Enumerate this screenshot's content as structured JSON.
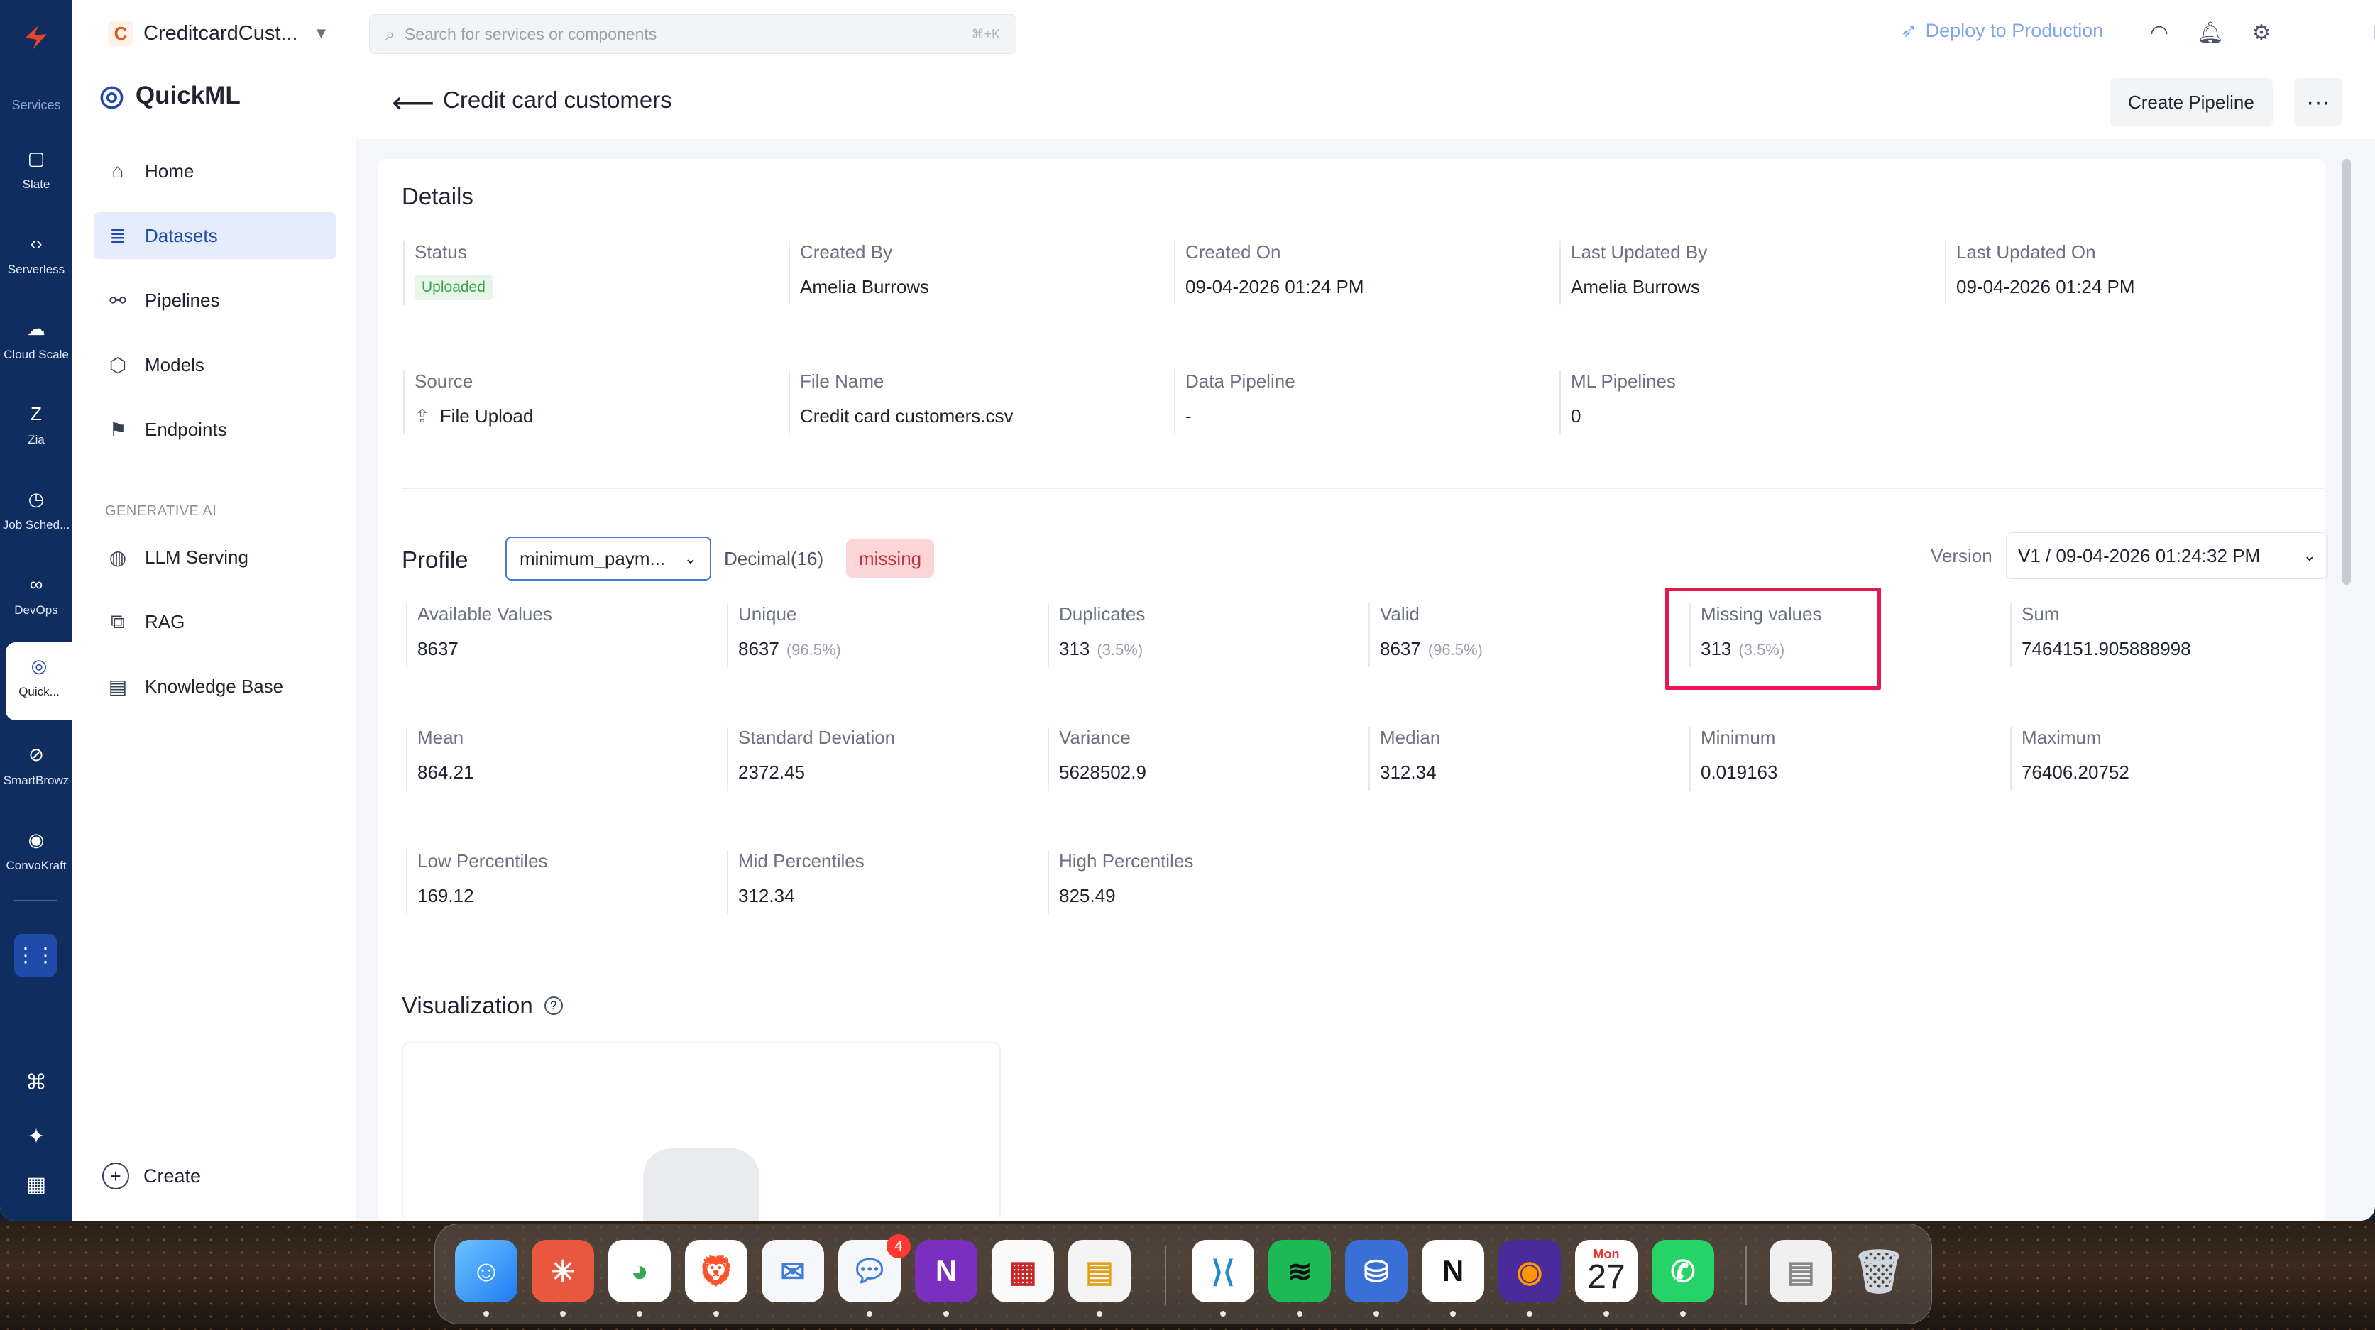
{
  "rail": {
    "services_label": "Services",
    "items": [
      {
        "label": "Slate",
        "icon": "slate-icon"
      },
      {
        "label": "Serverless",
        "icon": "serverless-icon"
      },
      {
        "label": "Cloud Scale",
        "icon": "cloud-scale-icon"
      },
      {
        "label": "Zia",
        "icon": "zia-icon"
      },
      {
        "label": "Job Sched...",
        "icon": "job-scheduling-icon"
      },
      {
        "label": "DevOps",
        "icon": "devops-icon"
      },
      {
        "label": "Quick...",
        "icon": "quickml-icon"
      },
      {
        "label": "SmartBrowz",
        "icon": "smartbrowz-icon"
      },
      {
        "label": "ConvoKraft",
        "icon": "convokraft-icon"
      }
    ]
  },
  "topbar": {
    "project_initial": "C",
    "project_name": "CreditcardCust...",
    "search_placeholder": "Search for services or components",
    "search_shortcut": "⌘+K",
    "deploy_label": "Deploy to Production"
  },
  "sidebar": {
    "title": "QuickML",
    "items": [
      {
        "label": "Home"
      },
      {
        "label": "Datasets"
      },
      {
        "label": "Pipelines"
      },
      {
        "label": "Models"
      },
      {
        "label": "Endpoints"
      }
    ],
    "section_label": "GENERATIVE AI",
    "gen_items": [
      {
        "label": "LLM Serving"
      },
      {
        "label": "RAG"
      },
      {
        "label": "Knowledge Base"
      }
    ],
    "create_label": "Create"
  },
  "page": {
    "title": "Credit card customers",
    "create_pipeline": "Create Pipeline",
    "more": "···"
  },
  "details": {
    "heading": "Details",
    "status_label": "Status",
    "status_value": "Uploaded",
    "created_by_label": "Created By",
    "created_by": "Amelia Burrows",
    "created_on_label": "Created On",
    "created_on": "09-04-2026 01:24 PM",
    "updated_by_label": "Last Updated By",
    "updated_by": "Amelia Burrows",
    "updated_on_label": "Last Updated On",
    "updated_on": "09-04-2026 01:24 PM",
    "source_label": "Source",
    "source_value": "File Upload",
    "file_name_label": "File Name",
    "file_name": "Credit card customers.csv",
    "data_pipeline_label": "Data Pipeline",
    "data_pipeline": "-",
    "ml_pipelines_label": "ML Pipelines",
    "ml_pipelines": "0"
  },
  "profile": {
    "heading": "Profile",
    "column": "minimum_paym...",
    "dtype": "Decimal(16)",
    "tag": "missing",
    "version_label": "Version",
    "version_value": "V1 / 09-04-2026 01:24:32 PM",
    "stats": [
      {
        "label": "Available Values",
        "value": "8637",
        "sub": ""
      },
      {
        "label": "Unique",
        "value": "8637",
        "sub": "(96.5%)"
      },
      {
        "label": "Duplicates",
        "value": "313",
        "sub": "(3.5%)"
      },
      {
        "label": "Valid",
        "value": "8637",
        "sub": "(96.5%)"
      },
      {
        "label": "Missing values",
        "value": "313",
        "sub": "(3.5%)"
      },
      {
        "label": "Sum",
        "value": "7464151.905888998",
        "sub": ""
      },
      {
        "label": "Mean",
        "value": "864.21",
        "sub": ""
      },
      {
        "label": "Standard Deviation",
        "value": "2372.45",
        "sub": ""
      },
      {
        "label": "Variance",
        "value": "5628502.9",
        "sub": ""
      },
      {
        "label": "Median",
        "value": "312.34",
        "sub": ""
      },
      {
        "label": "Minimum",
        "value": "0.019163",
        "sub": ""
      },
      {
        "label": "Maximum",
        "value": "76406.20752",
        "sub": ""
      },
      {
        "label": "Low Percentiles",
        "value": "169.12",
        "sub": ""
      },
      {
        "label": "Mid Percentiles",
        "value": "312.34",
        "sub": ""
      },
      {
        "label": "High Percentiles",
        "value": "825.49",
        "sub": ""
      }
    ]
  },
  "visualization": {
    "heading": "Visualization",
    "help": "?"
  },
  "dock": {
    "calendar_month": "Mon",
    "calendar_day": "27",
    "messages_badge": "4"
  }
}
